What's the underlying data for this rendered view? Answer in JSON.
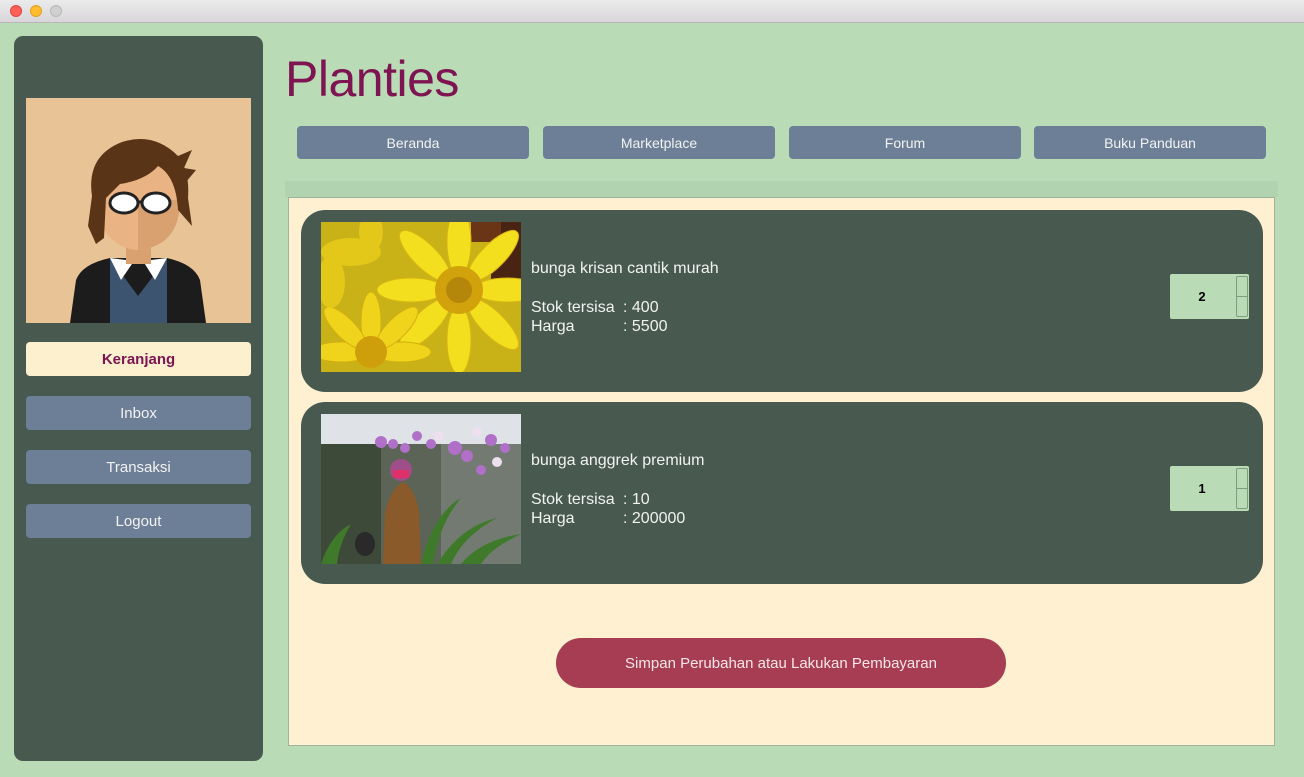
{
  "app": {
    "title": "Planties"
  },
  "sidebar": {
    "items": [
      {
        "label": "Keranjang",
        "active": true
      },
      {
        "label": "Inbox",
        "active": false
      },
      {
        "label": "Transaksi",
        "active": false
      },
      {
        "label": "Logout",
        "active": false
      }
    ]
  },
  "nav": {
    "tabs": [
      {
        "label": "Beranda"
      },
      {
        "label": "Marketplace"
      },
      {
        "label": "Forum"
      },
      {
        "label": "Buku Panduan"
      }
    ]
  },
  "cart": {
    "items": [
      {
        "name": "bunga krisan cantik murah",
        "stock_label": "Stok tersisa",
        "stock_value": ": 400",
        "price_label": "Harga",
        "price_value": ": 5500",
        "quantity": "2"
      },
      {
        "name": "bunga anggrek premium",
        "stock_label": "Stok tersisa",
        "stock_value": ": 10",
        "price_label": "Harga",
        "price_value": ": 200000",
        "quantity": "1"
      }
    ]
  },
  "actions": {
    "pay_label": "Simpan Perubahan atau Lakukan Pembayaran"
  },
  "colors": {
    "background": "#b9dcb6",
    "panel_dark": "#485a50",
    "button_blue": "#6d7f96",
    "title_maroon": "#7e1451",
    "content_cream": "#fef0d0",
    "pay_button": "#a63d52"
  }
}
